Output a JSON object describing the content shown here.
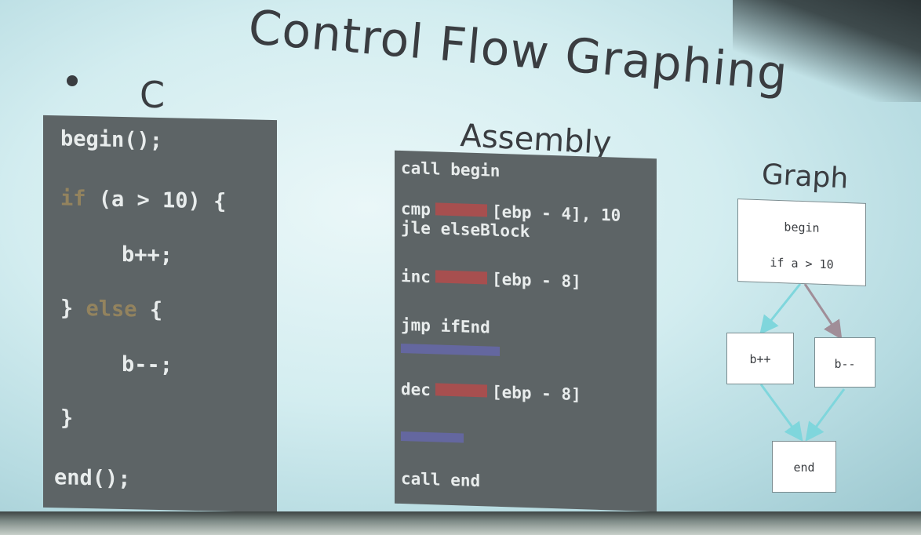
{
  "slide": {
    "title": "Control Flow Graphing",
    "c_heading": "C",
    "assembly_heading": "Assembly",
    "graph_heading": "Graph"
  },
  "c_code": {
    "line1": "begin();",
    "line2_kw": "if",
    "line2_rest": " (a > 10) {",
    "line3": "b++;",
    "line4_brace": "}",
    "line4_kw": "else",
    "line4_rest": " {",
    "line5": "b--;",
    "line6": "}",
    "line7": "end();"
  },
  "assembly_code": {
    "line1": "call begin",
    "line2_a": "cmp",
    "line2_b": "[ebp - 4], 10",
    "line3": "jle elseBlock",
    "line4_a": "inc",
    "line4_b": "[ebp - 8]",
    "line5": "jmp ifEnd",
    "line6_a": "dec",
    "line6_b": "[ebp - 8]",
    "line7": "call end"
  },
  "graph": {
    "node_begin_line1": "begin",
    "node_begin_line2": "if a > 10",
    "node_true": "b++",
    "node_false": "b--",
    "node_end": "end",
    "edge_colors": {
      "true": "#7fd6dc",
      "false": "#a08e98"
    }
  }
}
